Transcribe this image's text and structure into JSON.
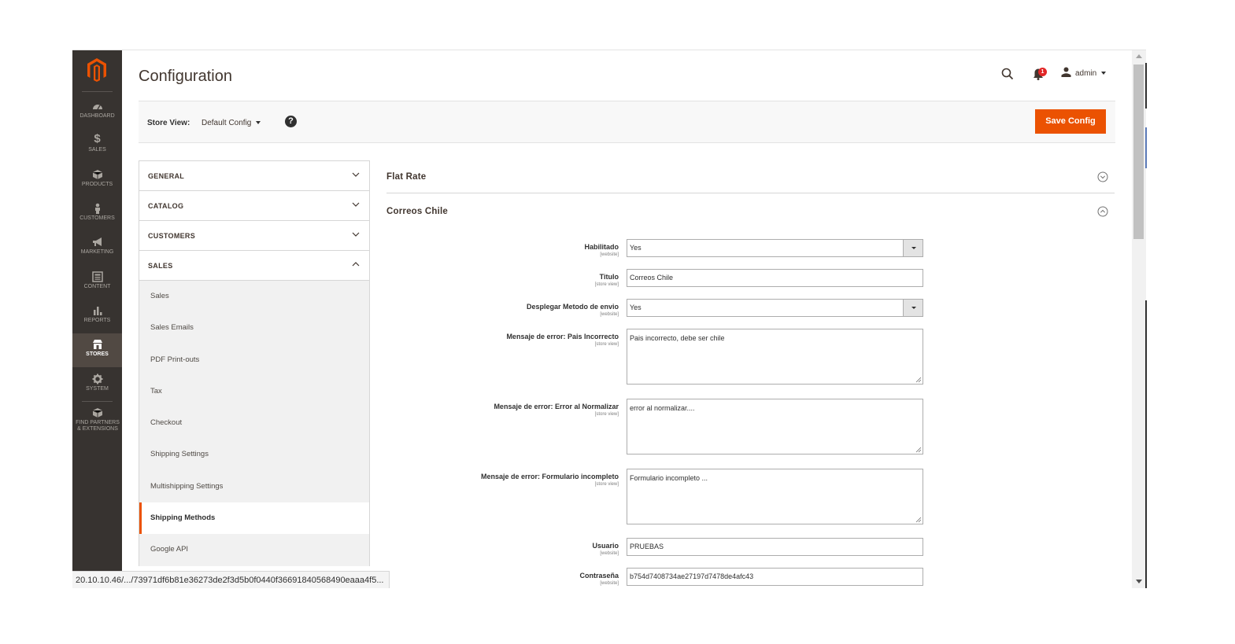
{
  "nav": {
    "items": [
      {
        "label": "DASHBOARD",
        "icon": "dashboard-icon"
      },
      {
        "label": "SALES",
        "icon": "dollar-icon"
      },
      {
        "label": "PRODUCTS",
        "icon": "cube-icon"
      },
      {
        "label": "CUSTOMERS",
        "icon": "person-icon"
      },
      {
        "label": "MARKETING",
        "icon": "megaphone-icon"
      },
      {
        "label": "CONTENT",
        "icon": "content-icon"
      },
      {
        "label": "REPORTS",
        "icon": "bar-chart-icon"
      },
      {
        "label": "STORES",
        "icon": "store-icon"
      },
      {
        "label": "SYSTEM",
        "icon": "gear-icon"
      },
      {
        "label": "FIND PARTNERS & EXTENSIONS",
        "icon": "box-icon"
      }
    ],
    "active": "STORES"
  },
  "header": {
    "title": "Configuration",
    "notifications_count": "1",
    "user": "admin"
  },
  "store_bar": {
    "label": "Store View:",
    "value": "Default Config",
    "save_label": "Save Config"
  },
  "tabs": {
    "groups": [
      {
        "label": "GENERAL"
      },
      {
        "label": "CATALOG"
      },
      {
        "label": "CUSTOMERS"
      },
      {
        "label": "SALES"
      }
    ],
    "sales_items": [
      "Sales",
      "Sales Emails",
      "PDF Print-outs",
      "Tax",
      "Checkout",
      "Shipping Settings",
      "Multishipping Settings",
      "Shipping Methods",
      "Google API"
    ],
    "active_item": "Shipping Methods"
  },
  "sections": {
    "flat_rate": "Flat Rate",
    "correos": "Correos Chile"
  },
  "form": {
    "habilitado": {
      "label": "Habilitado",
      "scope": "[website]",
      "value": "Yes"
    },
    "titulo": {
      "label": "Titulo",
      "scope": "[store view]",
      "value": "Correos Chile"
    },
    "desplegar": {
      "label": "Desplegar Metodo de envio",
      "scope": "[website]",
      "value": "Yes"
    },
    "err_pais": {
      "label": "Mensaje de error: Pais Incorrecto",
      "scope": "[store view]",
      "value": "Pais incorrecto, debe ser chile"
    },
    "err_normalizar": {
      "label": "Mensaje de error: Error al Normalizar",
      "scope": "[store view]",
      "value": "error al normalizar...."
    },
    "err_formulario": {
      "label": "Mensaje de error: Formulario incompleto",
      "scope": "[store view]",
      "value": "Formulario incompleto ..."
    },
    "usuario": {
      "label": "Usuario",
      "scope": "[website]",
      "value": "PRUEBAS"
    },
    "contrasena": {
      "label": "Contraseña",
      "scope": "[website]",
      "value": "b754d7408734ae27197d7478de4afc43"
    }
  },
  "status_url": "20.10.10.46/.../73971df6b81e36273de2f3d5b0f0440f36691840568490eaaa4f5...",
  "colors": {
    "accent": "#eb5202",
    "nav_bg": "#373330",
    "badge": "#e22626"
  }
}
